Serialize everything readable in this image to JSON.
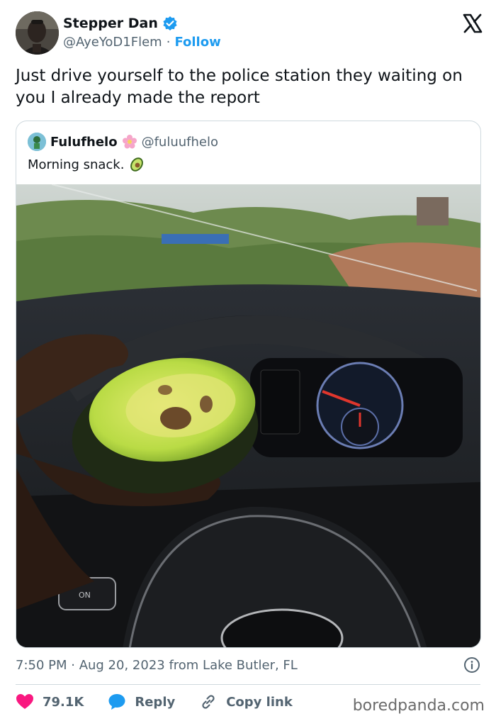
{
  "author": {
    "name": "Stepper Dan",
    "handle": "@AyeYoD1Flem",
    "separator": "·",
    "follow_label": "Follow"
  },
  "tweet": {
    "text": "Just drive yourself to the police station they waiting on you I already made the report"
  },
  "quote": {
    "name": "Fulufhelo",
    "handle": "@fuluufhelo",
    "text": "Morning snack."
  },
  "meta": {
    "text": "7:50 PM · Aug 20, 2023 from Lake Butler, FL"
  },
  "actions": {
    "likes": "79.1K",
    "reply": "Reply",
    "copy_link": "Copy link"
  },
  "watermark": "boredpanda.com",
  "icons": {
    "verified": "verified-badge-icon",
    "x": "x-logo-icon",
    "info": "info-icon",
    "heart": "heart-icon",
    "reply": "reply-bubble-icon",
    "link": "link-icon",
    "flower": "flower-emoji-icon",
    "avocado": "avocado-emoji-icon"
  },
  "colors": {
    "accent": "#1d9bf0",
    "like": "#f91880",
    "text": "#0f1419",
    "muted": "#536471"
  }
}
